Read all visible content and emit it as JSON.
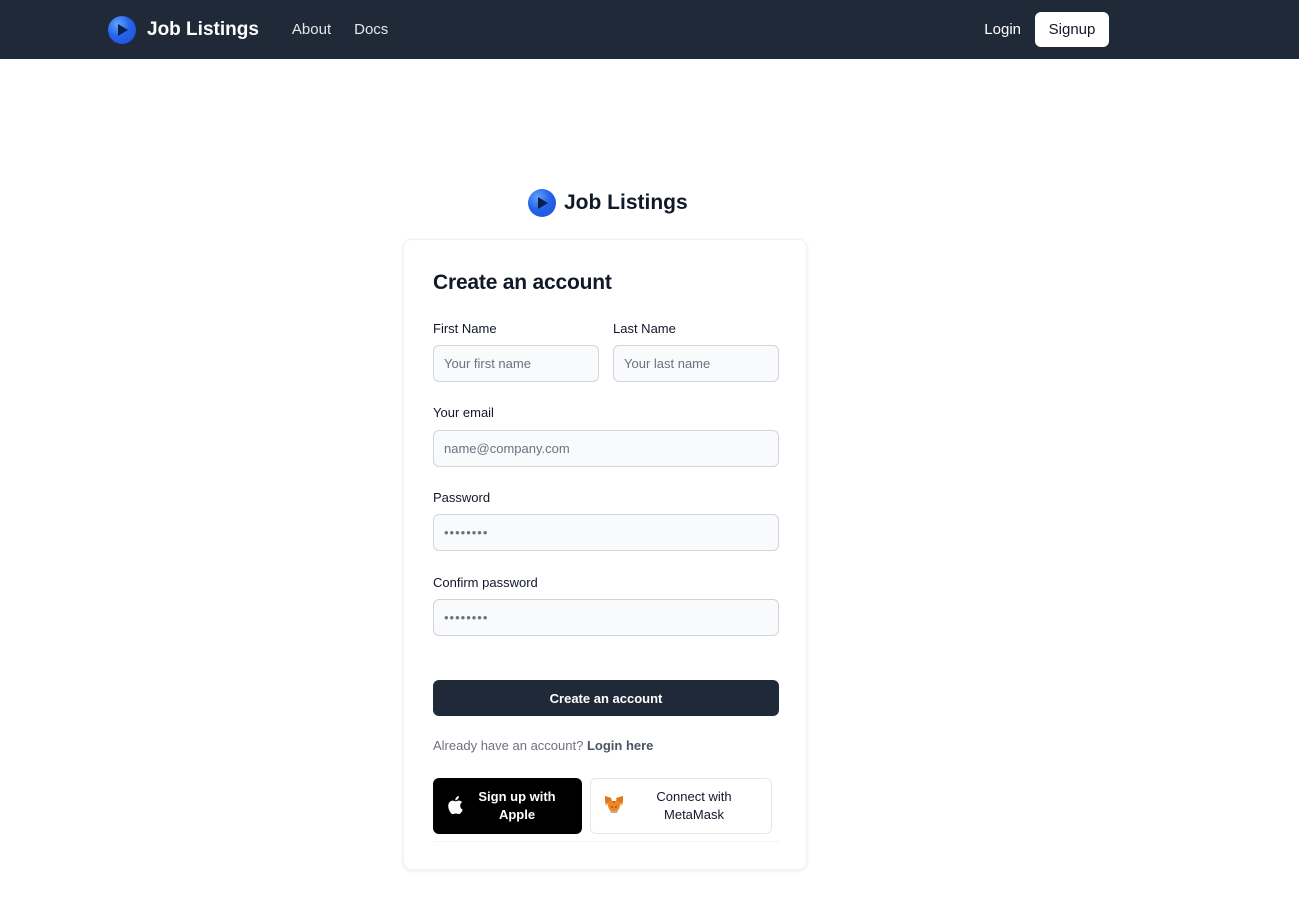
{
  "nav": {
    "brand": "Job Listings",
    "links": [
      "About",
      "Docs"
    ],
    "login": "Login",
    "signup": "Signup"
  },
  "header": {
    "brand": "Job Listings"
  },
  "form": {
    "title": "Create an account",
    "first_name": {
      "label": "First Name",
      "placeholder": "Your first name"
    },
    "last_name": {
      "label": "Last Name",
      "placeholder": "Your last name"
    },
    "email": {
      "label": "Your email",
      "placeholder": "name@company.com"
    },
    "password": {
      "label": "Password",
      "placeholder": "••••••••"
    },
    "confirm_password": {
      "label": "Confirm password",
      "placeholder": "••••••••"
    },
    "submit": "Create an account",
    "already_text": "Already have an account?",
    "login_link": "Login here",
    "apple_button": "Sign up with Apple",
    "metamask_button": "Connect with MetaMask"
  },
  "colors": {
    "navbar_bg": "#1f2937",
    "primary_button": "#1f2937",
    "input_bg": "#f9fafb",
    "brand_blue": "#2563eb"
  },
  "icons": {
    "brand_logo": "play-logo-icon",
    "apple": "apple-icon",
    "metamask": "metamask-fox-icon"
  }
}
